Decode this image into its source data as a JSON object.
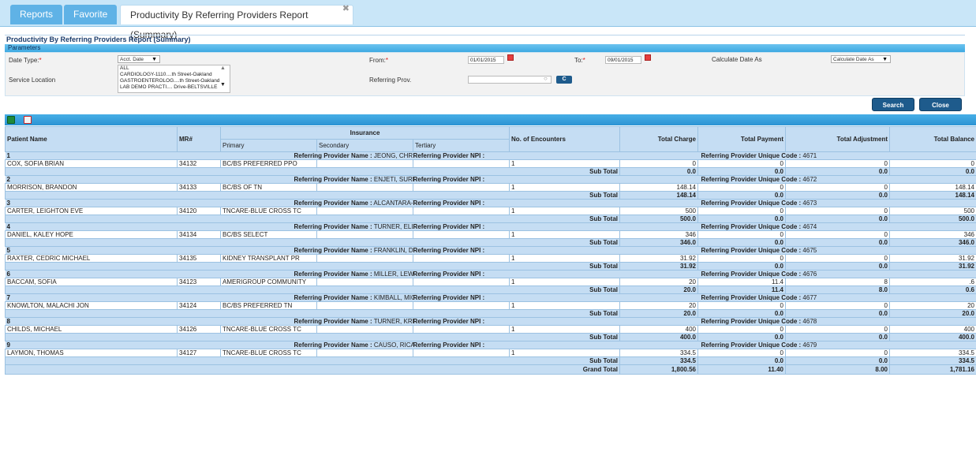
{
  "tabs": [
    {
      "label": "Reports"
    },
    {
      "label": "Favorite"
    },
    {
      "label": "Productivity By Referring Providers Report (Summary)"
    }
  ],
  "panel_title": "Productivity By Referring Providers Report (Summary)",
  "params": {
    "title": "Parameters",
    "date_type_label": "Date Type:",
    "date_type_value": "Acct. Date",
    "from_label": "From:",
    "from_value": "01/01/2015",
    "to_label": "To:",
    "to_value": "09/01/2015",
    "calc_label": "Calculate Date As",
    "calc_value": "Calculate Date As",
    "service_location_label": "Service Location",
    "service_locations": [
      "ALL",
      "CARDIOLOGY-1110....th Street-Oakland",
      "GASTROENTEROLOG....th Street-Oakland",
      "LAB DEMO PRACTI.... Drive-BELTSVILLE"
    ],
    "referring_label": "Referring Prov.",
    "c_button": "C"
  },
  "buttons": {
    "search": "Search",
    "close": "Close"
  },
  "table": {
    "headers": {
      "patient": "Patient Name",
      "mr": "MR#",
      "insurance": "Insurance",
      "primary": "Primary",
      "secondary": "Secondary",
      "tertiary": "Tertiary",
      "encounters": "No. of Encounters",
      "charge": "Total Charge",
      "payment": "Total Payment",
      "adjustment": "Total Adjustment",
      "balance": "Total Balance"
    },
    "ref_name_label": "Referring Provider Name :",
    "ref_npi_label": "Referring Provider NPI :",
    "ref_code_label": "Referring Provider Unique Code :",
    "subtotal_label": "Sub Total",
    "grand_label": "Grand Total",
    "groups": [
      {
        "num": "1",
        "provider": "JEONG, CHRISTINE",
        "code": "4671",
        "patient": "COX, SOFIA BRIAN",
        "mr": "34132",
        "primary": "BC/BS PREFERRED PPO",
        "enc": "1",
        "charge": "0",
        "payment": "0",
        "adjustment": "0",
        "balance": "0",
        "sub_charge": "0.0",
        "sub_payment": "0.0",
        "sub_adjustment": "0.0",
        "sub_balance": "0.0"
      },
      {
        "num": "2",
        "provider": "ENJETI, SURESH",
        "code": "4672",
        "patient": "MORRISON, BRANDON",
        "mr": "34133",
        "primary": "BC/BS OF TN",
        "enc": "1",
        "charge": "148.14",
        "payment": "0",
        "adjustment": "0",
        "balance": "148.14",
        "sub_charge": "148.14",
        "sub_payment": "0.0",
        "sub_adjustment": "0.0",
        "sub_balance": "148.14"
      },
      {
        "num": "3",
        "provider": "ALCANTARA-WOLFORD, KARIN",
        "code": "4673",
        "patient": "CARTER, LEIGHTON EVE",
        "mr": "34120",
        "primary": "TNCARE-BLUE CROSS TC",
        "enc": "1",
        "charge": "500",
        "payment": "0",
        "adjustment": "0",
        "balance": "500",
        "sub_charge": "500.0",
        "sub_payment": "0.0",
        "sub_adjustment": "0.0",
        "sub_balance": "500.0"
      },
      {
        "num": "4",
        "provider": "TURNER, ELIZABETH",
        "code": "4674",
        "patient": "DANIEL, KALEY HOPE",
        "mr": "34134",
        "primary": "BC/BS SELECT",
        "enc": "1",
        "charge": "346",
        "payment": "0",
        "adjustment": "0",
        "balance": "346",
        "sub_charge": "346.0",
        "sub_payment": "0.0",
        "sub_adjustment": "0.0",
        "sub_balance": "346.0"
      },
      {
        "num": "5",
        "provider": "FRANKLIN, DON",
        "code": "4675",
        "patient": "RAXTER, CEDRIC MICHAEL",
        "mr": "34135",
        "primary": "KIDNEY TRANSPLANT PR",
        "enc": "1",
        "charge": "31.92",
        "payment": "0",
        "adjustment": "0",
        "balance": "31.92",
        "sub_charge": "31.92",
        "sub_payment": "0.0",
        "sub_adjustment": "0.0",
        "sub_balance": "31.92"
      },
      {
        "num": "6",
        "provider": "MILLER, LEWIS",
        "code": "4676",
        "patient": "BACCAM, SOFIA",
        "mr": "34123",
        "primary": "AMERIGROUP COMMUNITY",
        "enc": "1",
        "charge": "20",
        "payment": "11.4",
        "adjustment": "8",
        "balance": ".6",
        "sub_charge": "20.0",
        "sub_payment": "11.4",
        "sub_adjustment": "8.0",
        "sub_balance": "0.6"
      },
      {
        "num": "7",
        "provider": "KIMBALL, MICHELLE",
        "code": "4677",
        "patient": "KNOWLTON, MALACHI JON",
        "mr": "34124",
        "primary": "BC/BS PREFERRED TN",
        "enc": "1",
        "charge": "20",
        "payment": "0",
        "adjustment": "0",
        "balance": "20",
        "sub_charge": "20.0",
        "sub_payment": "0.0",
        "sub_adjustment": "0.0",
        "sub_balance": "20.0"
      },
      {
        "num": "8",
        "provider": "TURNER, KRISTEN",
        "code": "4678",
        "patient": "CHILDS, MICHAEL",
        "mr": "34126",
        "primary": "TNCARE-BLUE CROSS TC",
        "enc": "1",
        "charge": "400",
        "payment": "0",
        "adjustment": "0",
        "balance": "400",
        "sub_charge": "400.0",
        "sub_payment": "0.0",
        "sub_adjustment": "0.0",
        "sub_balance": "400.0"
      },
      {
        "num": "9",
        "provider": "CAUSO, RICARDO",
        "code": "4679",
        "patient": "LAYMON, THOMAS",
        "mr": "34127",
        "primary": "TNCARE-BLUE CROSS TC",
        "enc": "1",
        "charge": "334.5",
        "payment": "0",
        "adjustment": "0",
        "balance": "334.5",
        "sub_charge": "334.5",
        "sub_payment": "0.0",
        "sub_adjustment": "0.0",
        "sub_balance": "334.5"
      }
    ],
    "grand": {
      "charge": "1,800.56",
      "payment": "11.40",
      "adjustment": "8.00",
      "balance": "1,781.16"
    }
  }
}
